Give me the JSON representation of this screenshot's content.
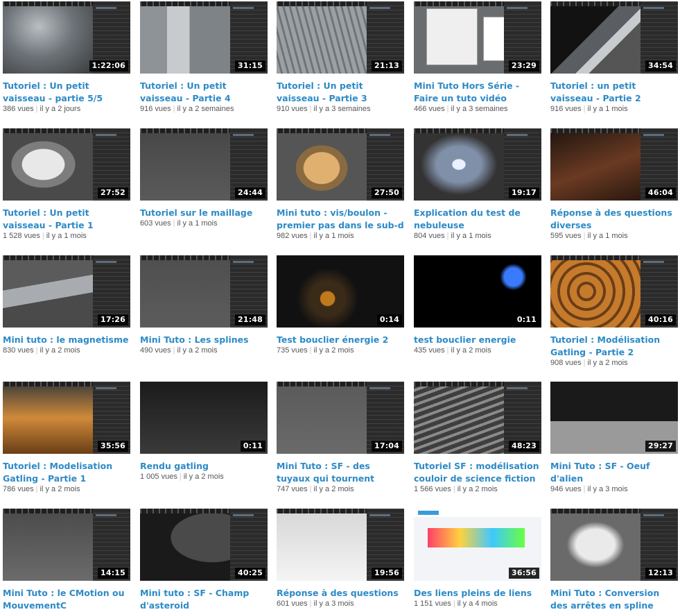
{
  "videos": [
    {
      "title": "Tutoriel : Un petit vaisseau - partie 5/5",
      "views": "386 vues",
      "age": "il y a 2 jours",
      "duration": "1:22:06"
    },
    {
      "title": "Tutoriel : Un petit vaisseau - Partie 4",
      "views": "916 vues",
      "age": "il y a 2 semaines",
      "duration": "31:15"
    },
    {
      "title": "Tutoriel : Un petit vaisseau - Partie 3",
      "views": "910 vues",
      "age": "il y a 3 semaines",
      "duration": "21:13"
    },
    {
      "title": "Mini Tuto Hors Série - Faire un tuto vidéo",
      "views": "466 vues",
      "age": "il y a 3 semaines",
      "duration": "23:29"
    },
    {
      "title": "Tutoriel : un petit vaisseau - Partie 2",
      "views": "916 vues",
      "age": "il y a 1 mois",
      "duration": "34:54"
    },
    {
      "title": "Tutoriel : Un petit vaisseau - Partie 1",
      "views": "1 528 vues",
      "age": "il y a 1 mois",
      "duration": "27:52"
    },
    {
      "title": "Tutoriel sur le maillage",
      "views": "603 vues",
      "age": "il y a 1 mois",
      "duration": "24:44"
    },
    {
      "title": "Mini tuto : vis/boulon - premier pas dans le sub-d ...",
      "views": "982 vues",
      "age": "il y a 1 mois",
      "duration": "27:50"
    },
    {
      "title": "Explication du test de nebuleuse",
      "views": "804 vues",
      "age": "il y a 1 mois",
      "duration": "19:17"
    },
    {
      "title": "Réponse à des questions diverses",
      "views": "595 vues",
      "age": "il y a 1 mois",
      "duration": "46:04"
    },
    {
      "title": "Mini tuto : le magnetisme",
      "views": "830 vues",
      "age": "il y a 2 mois",
      "duration": "17:26"
    },
    {
      "title": "Mini Tuto : Les splines",
      "views": "490 vues",
      "age": "il y a 2 mois",
      "duration": "21:48"
    },
    {
      "title": "Test bouclier énergie 2",
      "views": "735 vues",
      "age": "il y a 2 mois",
      "duration": "0:14"
    },
    {
      "title": "test bouclier energie",
      "views": "435 vues",
      "age": "il y a 2 mois",
      "duration": "0:11"
    },
    {
      "title": "Tutoriel : Modélisation Gatling - Partie 2",
      "views": "908 vues",
      "age": "il y a 2 mois",
      "duration": "40:16"
    },
    {
      "title": "Tutoriel : Modelisation Gatling - Partie 1",
      "views": "786 vues",
      "age": "il y a 2 mois",
      "duration": "35:56"
    },
    {
      "title": "Rendu gatling",
      "views": "1 005 vues",
      "age": "il y a 2 mois",
      "duration": "0:11"
    },
    {
      "title": "Mini Tuto : SF - des tuyaux qui tournent",
      "views": "747 vues",
      "age": "il y a 2 mois",
      "duration": "17:04"
    },
    {
      "title": "Tutoriel SF : modélisation couloir de science fiction",
      "views": "1 566 vues",
      "age": "il y a 2 mois",
      "duration": "48:23"
    },
    {
      "title": "Mini Tuto : SF - Oeuf d'alien",
      "views": "946 vues",
      "age": "il y a 3 mois",
      "duration": "29:27"
    },
    {
      "title": "Mini Tuto : le CMotion ou MouvementC",
      "views": "",
      "age": "",
      "duration": "14:15"
    },
    {
      "title": "Mini tuto : SF - Champ d'asteroid",
      "views": "",
      "age": "",
      "duration": "40:25"
    },
    {
      "title": "Réponse à des questions",
      "views": "601 vues",
      "age": "il y a 3 mois",
      "duration": "19:56"
    },
    {
      "title": "Des liens pleins de liens",
      "views": "1 151 vues",
      "age": "il y a 4 mois",
      "duration": "36:56"
    },
    {
      "title": "Mini Tuto : Conversion des arrêtes en spline",
      "views": "",
      "age": "",
      "duration": "12:13"
    }
  ]
}
